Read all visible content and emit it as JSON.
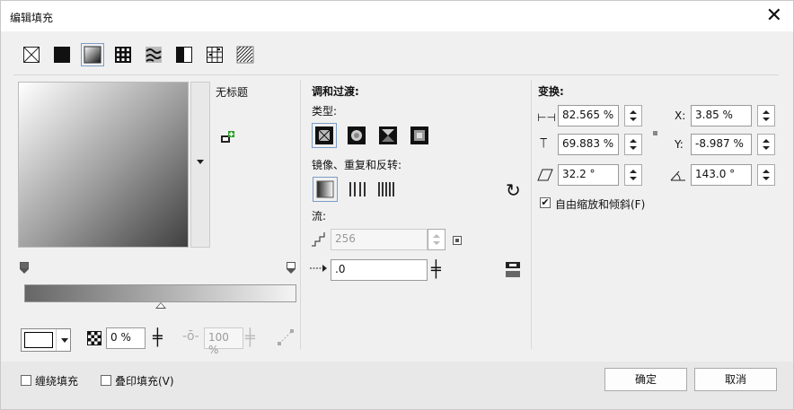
{
  "window": {
    "title": "编辑填充",
    "close_glyph": "✕"
  },
  "fill_types": [
    {
      "name": "no-fill"
    },
    {
      "name": "uniform-fill"
    },
    {
      "name": "fountain-fill",
      "selected": true
    },
    {
      "name": "vector-pattern-fill"
    },
    {
      "name": "bitmap-pattern-fill"
    },
    {
      "name": "two-color-pattern-fill"
    },
    {
      "name": "texture-fill"
    },
    {
      "name": "postscript-fill"
    }
  ],
  "preview": {
    "preset_name": "无标题"
  },
  "nodes": {
    "start_color": "#666666",
    "end_color": "#f4f4f4"
  },
  "node_controls": {
    "transparency_value": "0 %",
    "position_value": "100 %"
  },
  "blend": {
    "title": "调和过渡:",
    "type_label": "类型:",
    "mirror_label": "镜像、重复和反转:",
    "flow_label": "流:",
    "steps_value": "256",
    "acceleration_value": ".0"
  },
  "transform": {
    "title": "变换:",
    "width_value": "82.565 %",
    "height_value": "69.883 %",
    "skew_value": "32.2 °",
    "x_label": "X:",
    "x_value": "3.85 %",
    "y_label": "Y:",
    "y_value": "-8.987 %",
    "rotate_value": "143.0 °",
    "free_scale_label": "自由缩放和倾斜(F)",
    "free_scale_checked": true
  },
  "footer": {
    "wrap_fill_label": "缠绕填充",
    "overprint_label": "叠印填充(V)",
    "ok_label": "确定",
    "cancel_label": "取消"
  },
  "colors": {
    "accent": "#7a9cc6",
    "gradient_start": "#666666",
    "gradient_end": "#f4f4f4"
  }
}
